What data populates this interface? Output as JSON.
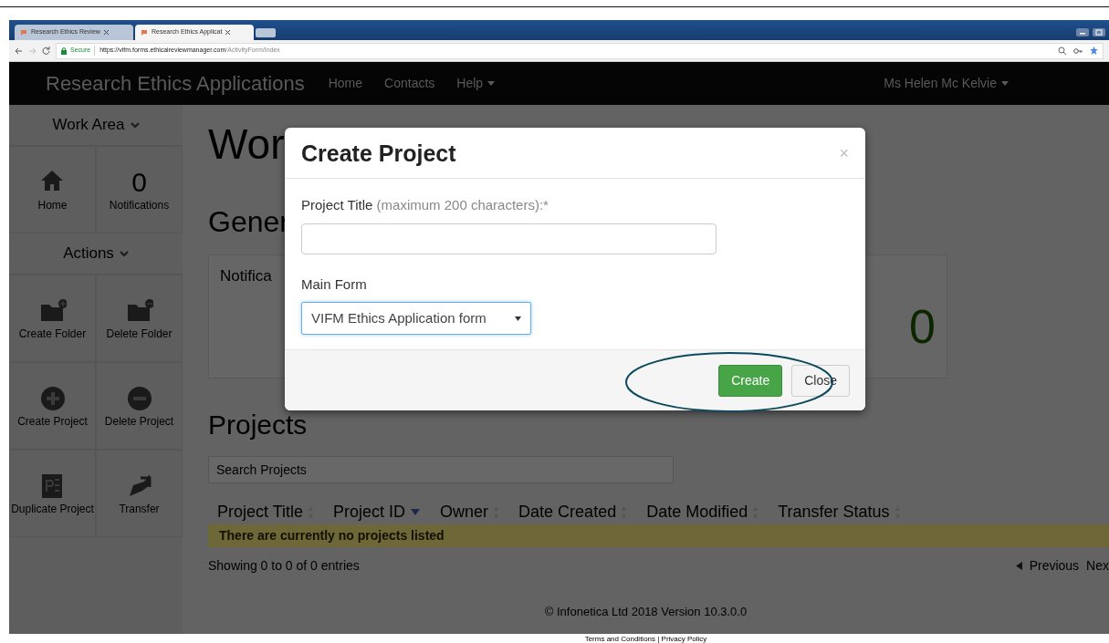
{
  "browser": {
    "tabs": [
      {
        "label": "Research Ethics Review",
        "selected": false
      },
      {
        "label": "Research Ethics Applicat",
        "selected": true
      }
    ],
    "secure_label": "Secure",
    "url_host": "https://vifm.forms.ethicalreviewmanager.com",
    "url_path": "/ActivityForm/Index"
  },
  "navbar": {
    "brand": "Research Ethics Applications",
    "links": [
      {
        "label": "Home",
        "dropdown": false
      },
      {
        "label": "Contacts",
        "dropdown": false
      },
      {
        "label": "Help",
        "dropdown": true
      }
    ],
    "user": "Ms Helen Mc Kelvie"
  },
  "sidebar": {
    "sections": [
      {
        "title": "Work Area",
        "items": [
          {
            "kind": "icon",
            "label": "Home"
          },
          {
            "kind": "count",
            "count": "0",
            "label": "Notifications"
          }
        ]
      },
      {
        "title": "Actions",
        "items": [
          {
            "kind": "icon",
            "label": "Create Folder"
          },
          {
            "kind": "icon",
            "label": "Delete Folder"
          },
          {
            "kind": "icon",
            "label": "Create Project"
          },
          {
            "kind": "icon",
            "label": "Delete Project"
          },
          {
            "kind": "icon",
            "label": "Duplicate Project"
          },
          {
            "kind": "icon",
            "label": "Transfer"
          }
        ]
      }
    ]
  },
  "main": {
    "heading": "Wor",
    "subheading": "Gener",
    "notifications_panel": {
      "title": "Notifica",
      "count": "0"
    },
    "projects_heading": "Projects",
    "search": {
      "placeholder": "Search Projects"
    },
    "table": {
      "columns": [
        {
          "label": "Project Title",
          "sorted": false
        },
        {
          "label": "Project ID",
          "sorted": true
        },
        {
          "label": "Owner",
          "sorted": false
        },
        {
          "label": "Date Created",
          "sorted": false
        },
        {
          "label": "Date Modified",
          "sorted": false
        },
        {
          "label": "Transfer Status",
          "sorted": false
        }
      ],
      "empty_message": "There are currently no projects listed"
    },
    "info": "Showing 0 to 0 of 0 entries",
    "pagination": [
      "Previous",
      "Nex"
    ]
  },
  "footer": {
    "copyright": "© Infonetica Ltd 2018 Version 10.3.0.0",
    "links": "Terms and Conditions | Privacy Policy"
  },
  "modal": {
    "title": "Create Project",
    "close": "×",
    "fields": [
      {
        "kind": "text",
        "label": "Project Title",
        "hint": "(maximum 200 characters):*"
      },
      {
        "kind": "select",
        "label": "Main Form",
        "value": "VIFM Ethics Application form",
        "focused": true
      }
    ],
    "buttons": [
      {
        "label": "Create",
        "kind": "primary"
      },
      {
        "label": "Close",
        "kind": "default"
      }
    ]
  }
}
